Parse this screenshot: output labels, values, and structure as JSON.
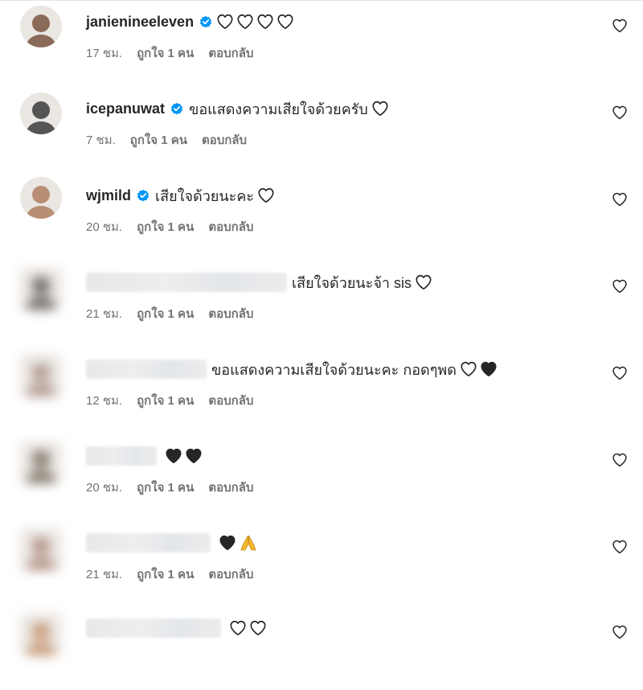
{
  "comments": [
    {
      "username": "janienineeleven",
      "verified": true,
      "text": "",
      "emoji": [
        "white-heart",
        "white-heart",
        "white-heart",
        "white-heart"
      ],
      "time": "17 ชม.",
      "likes": "ถูกใจ 1 คน",
      "reply": "ตอบกลับ",
      "avatar_color": "#8a6a58"
    },
    {
      "username": "icepanuwat",
      "verified": true,
      "text": "ขอแสดงความเสียใจด้วยครับ",
      "emoji": [
        "white-heart"
      ],
      "time": "7 ชม.",
      "likes": "ถูกใจ 1 คน",
      "reply": "ตอบกลับ",
      "avatar_color": "#555555"
    },
    {
      "username": "wjmild",
      "verified": true,
      "text": "เสียใจด้วยนะคะ",
      "emoji": [
        "white-heart"
      ],
      "time": "20 ชม.",
      "likes": "ถูกใจ 1 คน",
      "reply": "ตอบกลับ",
      "avatar_color": "#b88e74"
    },
    {
      "username": "",
      "verified": false,
      "text": "เสียใจด้วยนะจ้า sis",
      "emoji": [
        "white-heart"
      ],
      "time": "21 ชม.",
      "likes": "ถูกใจ 1 คน",
      "reply": "ตอบกลับ",
      "avatar_color": "#6e6a66"
    },
    {
      "username": "",
      "verified": false,
      "text": "ขอแสดงความเสียใจด้วยนะคะ กอดๆพด",
      "emoji": [
        "white-heart",
        "black-heart"
      ],
      "time": "12 ชม.",
      "likes": "ถูกใจ 1 คน",
      "reply": "ตอบกลับ",
      "avatar_color": "#b09a8e"
    },
    {
      "username": "",
      "verified": false,
      "text": "",
      "emoji": [
        "black-heart",
        "black-heart"
      ],
      "time": "20 ชม.",
      "likes": "ถูกใจ 1 คน",
      "reply": "ตอบกลับ",
      "avatar_color": "#857a6e"
    },
    {
      "username": "",
      "verified": false,
      "text": "",
      "emoji": [
        "black-heart",
        "folded-hands"
      ],
      "time": "21 ชม.",
      "likes": "ถูกใจ 1 คน",
      "reply": "ตอบกลับ",
      "avatar_color": "#b49488"
    },
    {
      "username": "",
      "verified": false,
      "text": "",
      "emoji": [
        "white-heart",
        "white-heart"
      ],
      "time": "",
      "likes": "",
      "reply": "",
      "avatar_color": "#c89a78"
    }
  ],
  "colors": {
    "verified_badge": "#0095f6",
    "muted_text": "#737373",
    "primary_text": "#262626",
    "folded_hands": "#f5b82e"
  }
}
